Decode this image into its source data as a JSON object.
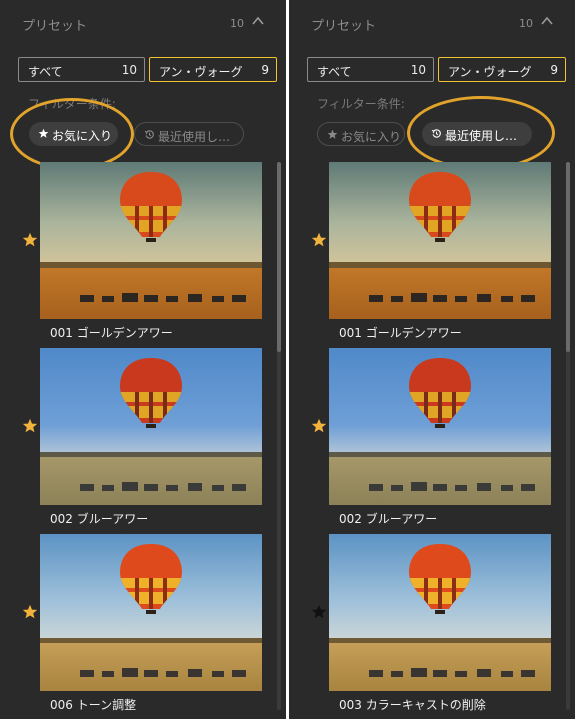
{
  "colors": {
    "panel_bg": "#2a2a2a",
    "accent_border": "#f2c231",
    "highlight_circle": "#e2a32c",
    "star_favorite": "#f2b33d",
    "star_inactive": "#111111"
  },
  "panels": [
    {
      "header": {
        "title": "プリセット",
        "count": "10",
        "caret_icon": "chevron-up-icon"
      },
      "segments": [
        {
          "label": "すべて",
          "count": "10"
        },
        {
          "label": "アン・ヴォーグ",
          "count": "9"
        }
      ],
      "filter": {
        "label": "フィルター条件:",
        "chips": [
          {
            "label": "お気に入り",
            "icon": "star-icon",
            "state": "active"
          },
          {
            "label": "最近使用し…",
            "icon": "history-icon",
            "state": "inactive"
          }
        ]
      },
      "items": [
        {
          "name": "001 ゴールデンアワー",
          "favorite": true,
          "photo": "golden"
        },
        {
          "name": "002 ブルーアワー",
          "favorite": true,
          "photo": "blue"
        },
        {
          "name": "006 トーン調整",
          "favorite": true,
          "photo": "tone"
        }
      ]
    },
    {
      "header": {
        "title": "プリセット",
        "count": "10",
        "caret_icon": "chevron-up-icon"
      },
      "segments": [
        {
          "label": "すべて",
          "count": "10"
        },
        {
          "label": "アン・ヴォーグ",
          "count": "9"
        }
      ],
      "filter": {
        "label": "フィルター条件:",
        "chips": [
          {
            "label": "お気に入り",
            "icon": "star-icon",
            "state": "inactive"
          },
          {
            "label": "最近使用し…",
            "icon": "history-icon",
            "state": "active"
          }
        ]
      },
      "items": [
        {
          "name": "001 ゴールデンアワー",
          "favorite": true,
          "photo": "golden"
        },
        {
          "name": "002 ブルーアワー",
          "favorite": true,
          "photo": "blue"
        },
        {
          "name": "003 カラーキャストの削除",
          "favorite": false,
          "photo": "tone"
        }
      ]
    }
  ]
}
